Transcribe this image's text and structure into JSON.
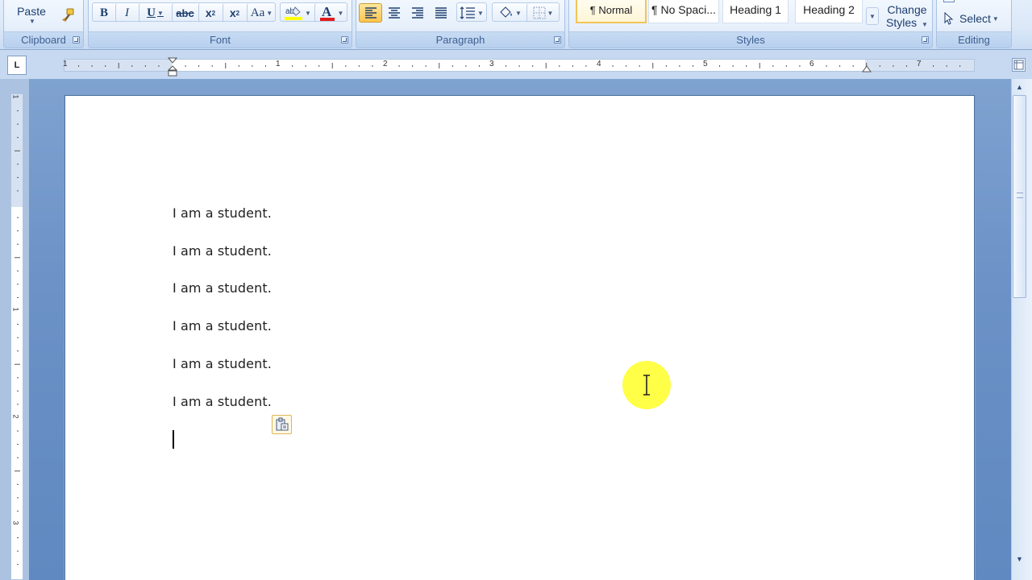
{
  "ribbon": {
    "clipboard": {
      "paste_label": "Paste",
      "group_label": "Clipboard"
    },
    "font": {
      "group_label": "Font",
      "bold": "B",
      "italic": "I",
      "underline": "U",
      "strikethrough": "abc",
      "subscript": "x",
      "superscript": "x",
      "change_case": "Aa",
      "font_color_letter": "A"
    },
    "paragraph": {
      "group_label": "Paragraph"
    },
    "styles": {
      "group_label": "Styles",
      "tiles": [
        "¶ Normal",
        "¶ No Spaci...",
        "Heading 1",
        "Heading 2"
      ],
      "change_styles_line1": "Change",
      "change_styles_line2": "Styles"
    },
    "editing": {
      "group_label": "Editing",
      "select_label": "Select"
    }
  },
  "ruler": {
    "tab_selector": "L",
    "h_numbers": [
      "1",
      "1",
      "2",
      "3",
      "4",
      "5",
      "6",
      "7"
    ],
    "v_numbers": [
      "1",
      "1",
      "2",
      "3"
    ]
  },
  "document": {
    "lines": [
      "I am a student.",
      "I am a student.",
      "I am a student.",
      "I am a student.",
      "I am a student.",
      "I am a student."
    ]
  },
  "colors": {
    "highlight_cursor": "#ffff33",
    "font_color_bar": "#e21b1b",
    "highlighter_bar": "#ffff00"
  }
}
